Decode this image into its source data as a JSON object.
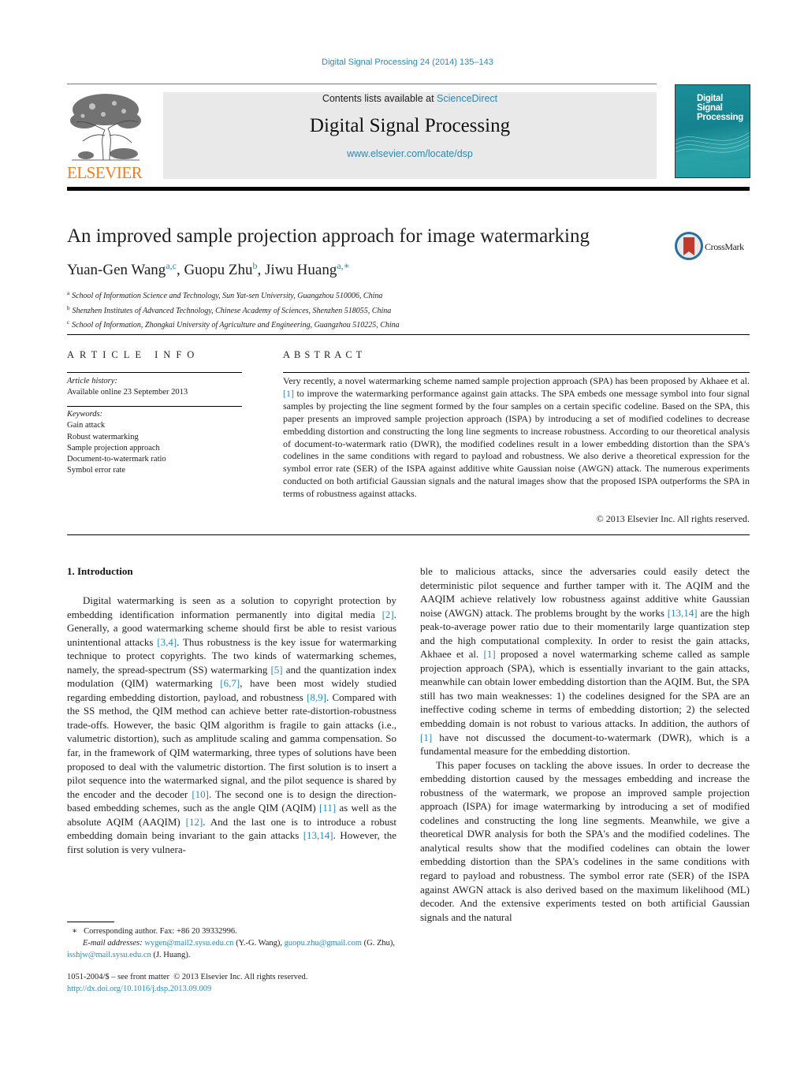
{
  "header": {
    "journal_ref": "Digital Signal Processing 24 (2014) 135–143",
    "contents_prefix": "Contents lists available at ",
    "contents_link": "ScienceDirect",
    "journal_title": "Digital Signal Processing",
    "journal_url": "www.elsevier.com/locate/dsp",
    "publisher_logo_text": "ELSEVIER",
    "cover_title_lines": [
      "Digital",
      "Signal",
      "Processing"
    ],
    "crossmark_label": "CrossMark"
  },
  "article": {
    "title": "An improved sample projection approach for image watermarking",
    "authors": [
      {
        "name": "Yuan-Gen Wang",
        "sup": "a,c"
      },
      {
        "name": "Guopu Zhu",
        "sup": "b"
      },
      {
        "name": "Jiwu Huang",
        "sup": "a,∗"
      }
    ],
    "affiliations": [
      {
        "mark": "a",
        "text": "School of Information Science and Technology, Sun Yat-sen University, Guangzhou 510006, China"
      },
      {
        "mark": "b",
        "text": "Shenzhen Institutes of Advanced Technology, Chinese Academy of Sciences, Shenzhen 518055, China"
      },
      {
        "mark": "c",
        "text": "School of Information, Zhongkai University of Agriculture and Engineering, Guangzhou 510225, China"
      }
    ]
  },
  "article_info": {
    "heading": "ARTICLE INFO",
    "history_label": "Article history:",
    "history_value": "Available online 23 September 2013",
    "keywords_label": "Keywords:",
    "keywords": [
      "Gain attack",
      "Robust watermarking",
      "Sample projection approach",
      "Document-to-watermark ratio",
      "Symbol error rate"
    ]
  },
  "abstract": {
    "heading": "ABSTRACT",
    "text_before_ref": "Very recently, a novel watermarking scheme named sample projection approach (SPA) has been proposed by Akhaee et al. ",
    "ref": "[1]",
    "text_after_ref": " to improve the watermarking performance against gain attacks. The SPA embeds one message symbol into four signal samples by projecting the line segment formed by the four samples on a certain specific codeline. Based on the SPA, this paper presents an improved sample projection approach (ISPA) by introducing a set of modified codelines to decrease embedding distortion and constructing the long line segments to increase robustness. According to our theoretical analysis of document-to-watermark ratio (DWR), the modified codelines result in a lower embedding distortion than the SPA's codelines in the same conditions with regard to payload and robustness. We also derive a theoretical expression for the symbol error rate (SER) of the ISPA against additive white Gaussian noise (AWGN) attack. The numerous experiments conducted on both artificial Gaussian signals and the natural images show that the proposed ISPA outperforms the SPA in terms of robustness against attacks.",
    "copyright": "© 2013 Elsevier Inc. All rights reserved."
  },
  "body": {
    "section_heading": "1. Introduction",
    "left_segments": [
      {
        "t": "Digital watermarking is seen as a solution to copyright protection by embedding identification information permanently into digital media "
      },
      {
        "r": "[2]"
      },
      {
        "t": ". Generally, a good watermarking scheme should first be able to resist various unintentional attacks "
      },
      {
        "r": "[3,4]"
      },
      {
        "t": ". Thus robustness is the key issue for watermarking technique to protect copyrights. The two kinds of watermarking schemes, namely, the spread-spectrum (SS) watermarking "
      },
      {
        "r": "[5]"
      },
      {
        "t": " and the quantization index modulation (QIM) watermarking "
      },
      {
        "r": "[6,7]"
      },
      {
        "t": ", have been most widely studied regarding embedding distortion, payload, and robustness "
      },
      {
        "r": "[8,9]"
      },
      {
        "t": ". Compared with the SS method, the QIM method can achieve better rate-distortion-robustness trade-offs. However, the basic QIM algorithm is fragile to gain attacks (i.e., valumetric distortion), such as amplitude scaling and gamma compensation. So far, in the framework of QIM watermarking, three types of solutions have been proposed to deal with the valumetric distortion. The first solution is to insert a pilot sequence into the watermarked signal, and the pilot sequence is shared by the encoder and the decoder "
      },
      {
        "r": "[10]"
      },
      {
        "t": ". The second one is to design the direction-based embedding schemes, such as the angle QIM (AQIM) "
      },
      {
        "r": "[11]"
      },
      {
        "t": " as well as the absolute AQIM (AAQIM) "
      },
      {
        "r": "[12]"
      },
      {
        "t": ". And the last one is to introduce a robust embedding domain being invariant to the gain attacks "
      },
      {
        "r": "[13,14]"
      },
      {
        "t": ". However, the first solution is very vulnera-"
      }
    ],
    "right_p1_segments": [
      {
        "t": "ble to malicious attacks, since the adversaries could easily detect the deterministic pilot sequence and further tamper with it. The AQIM and the AAQIM achieve relatively low robustness against additive white Gaussian noise (AWGN) attack. The problems brought by the works "
      },
      {
        "r": "[13,14]"
      },
      {
        "t": " are the high peak-to-average power ratio due to their momentarily large quantization step and the high computational complexity. In order to resist the gain attacks, Akhaee et al. "
      },
      {
        "r": "[1]"
      },
      {
        "t": " proposed a novel watermarking scheme called as sample projection approach (SPA), which is essentially invariant to the gain attacks, meanwhile can obtain lower embedding distortion than the AQIM. But, the SPA still has two main weaknesses: 1) the codelines designed for the SPA are an ineffective coding scheme in terms of embedding distortion; 2) the selected embedding domain is not robust to various attacks. In addition, the authors of "
      },
      {
        "r": "[1]"
      },
      {
        "t": " have not discussed the document-to-watermark (DWR), which is a fundamental measure for the embedding distortion."
      }
    ],
    "right_p2": "This paper focuses on tackling the above issues. In order to decrease the embedding distortion caused by the messages embedding and increase the robustness of the watermark, we propose an improved sample projection approach (ISPA) for image watermarking by introducing a set of modified codelines and constructing the long line segments. Meanwhile, we give a theoretical DWR analysis for both the SPA's and the modified codelines. The analytical results show that the modified codelines can obtain the lower embedding distortion than the SPA's codelines in the same conditions with regard to payload and robustness. The symbol error rate (SER) of the ISPA against AWGN attack is also derived based on the maximum likelihood (ML) decoder. And the extensive experiments tested on both artificial Gaussian signals and the natural"
  },
  "footnote": {
    "star": "∗",
    "corresponding": "Corresponding author. Fax: +86 20 39332996.",
    "email_label": "E-mail addresses:",
    "emails": [
      {
        "addr": "wygen@mail2.sysu.edu.cn",
        "who": " (Y.-G. Wang), "
      },
      {
        "addr": "guopu.zhu@gmail.com",
        "who": " (G. Zhu), "
      },
      {
        "addr": "isshjw@mail.sysu.edu.cn",
        "who": " (J. Huang)."
      }
    ]
  },
  "front_matter": {
    "issn": "1051-2004/$ – see front matter  © 2013 Elsevier Inc. All rights reserved.",
    "doi": "http://dx.doi.org/10.1016/j.dsp.2013.09.009"
  },
  "colors": {
    "link": "#2b8ab6",
    "elsevier_orange": "#f07f1a",
    "cover_teal": "#1a8e9a",
    "masthead_gray": "#e9e9e9"
  }
}
